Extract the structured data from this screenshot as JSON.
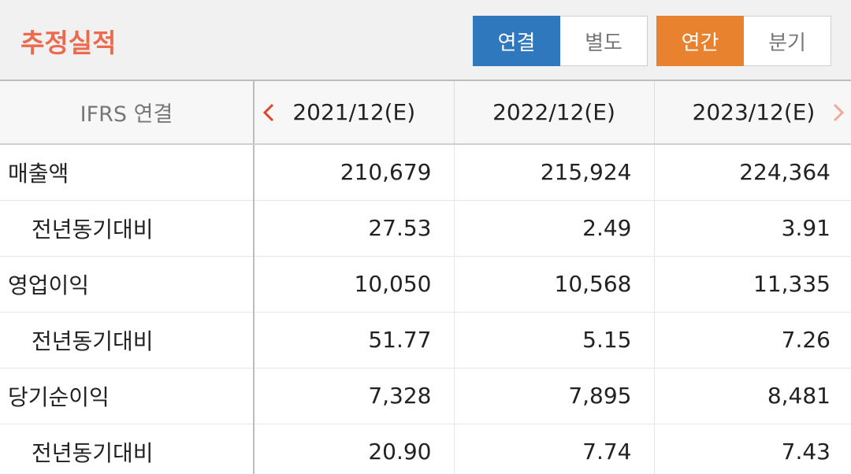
{
  "header": {
    "title": "추정실적",
    "scope_toggle": [
      {
        "label": "연결",
        "active": true
      },
      {
        "label": "별도",
        "active": false
      }
    ],
    "period_toggle": [
      {
        "label": "연간",
        "active": true
      },
      {
        "label": "분기",
        "active": false
      }
    ]
  },
  "table": {
    "corner_label": "IFRS 연결",
    "columns": [
      "2021/12(E)",
      "2022/12(E)",
      "2023/12(E)"
    ],
    "rows": [
      {
        "label": "매출액",
        "sub": false,
        "values": [
          "210,679",
          "215,924",
          "224,364"
        ]
      },
      {
        "label": "전년동기대비",
        "sub": true,
        "values": [
          "27.53",
          "2.49",
          "3.91"
        ]
      },
      {
        "label": "영업이익",
        "sub": false,
        "values": [
          "10,050",
          "10,568",
          "11,335"
        ]
      },
      {
        "label": "전년동기대비",
        "sub": true,
        "values": [
          "51.77",
          "5.15",
          "7.26"
        ]
      },
      {
        "label": "당기순이익",
        "sub": false,
        "values": [
          "7,328",
          "7,895",
          "8,481"
        ]
      },
      {
        "label": "전년동기대비",
        "sub": true,
        "values": [
          "20.90",
          "7.74",
          "7.43"
        ]
      }
    ]
  },
  "colors": {
    "title": "#ec6a4e",
    "active_scope": "#2f78be",
    "active_period": "#e8822f",
    "arrow_active": "#e0442a",
    "arrow_inactive": "#f2a89a"
  },
  "icons": {
    "prev": "chevron-left-icon",
    "next": "chevron-right-icon"
  }
}
